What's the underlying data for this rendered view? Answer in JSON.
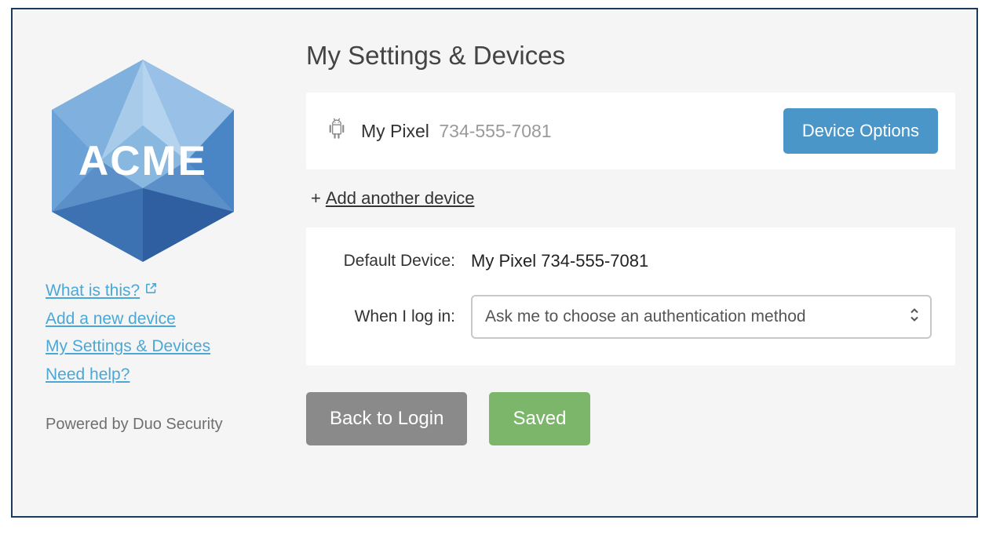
{
  "logo": {
    "text": "ACME"
  },
  "sidebar": {
    "links": {
      "what": "What is this?",
      "add": "Add a new device",
      "settings": "My Settings & Devices",
      "help": "Need help?"
    },
    "powered": "Powered by Duo Security"
  },
  "page": {
    "title": "My Settings & Devices"
  },
  "device": {
    "name": "My Pixel",
    "phone": "734-555-7081",
    "options_label": "Device Options"
  },
  "add_device": {
    "plus": "+",
    "label": "Add another device"
  },
  "settings": {
    "default_label": "Default Device:",
    "default_value": "My Pixel 734-555-7081",
    "login_label": "When I log in:",
    "login_select": "Ask me to choose an authentication method"
  },
  "actions": {
    "back": "Back to Login",
    "saved": "Saved"
  }
}
